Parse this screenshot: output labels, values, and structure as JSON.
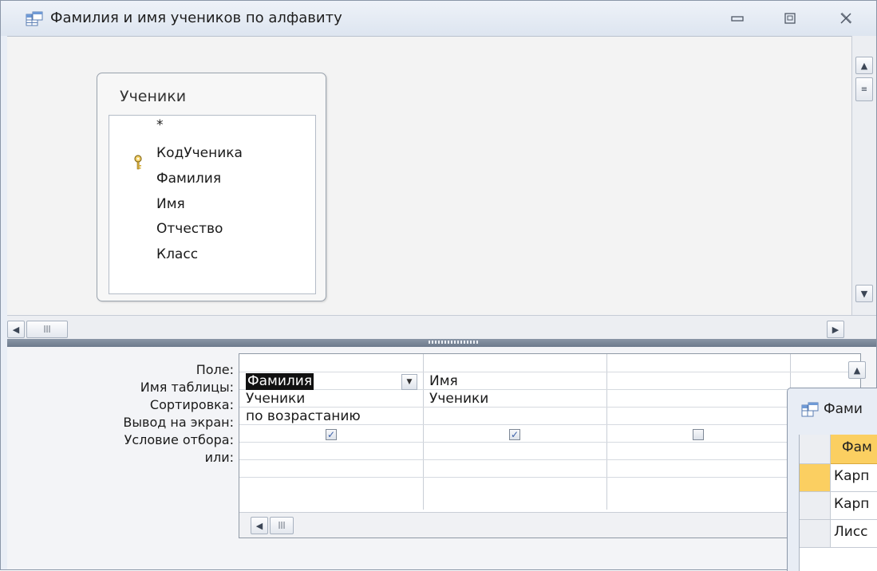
{
  "window": {
    "title": "Фамилия и имя учеников по алфавиту",
    "icon": "query-icon",
    "controls": [
      "minimize-icon",
      "restore-icon",
      "close-icon"
    ]
  },
  "diagram": {
    "table": {
      "name": "Ученики",
      "fields": [
        "*",
        "КодУченика",
        "Фамилия",
        "Имя",
        "Отчество",
        "Класс"
      ],
      "primary_key": "КодУченика"
    }
  },
  "design_grid": {
    "row_labels": {
      "field": "Поле:",
      "table": "Имя таблицы:",
      "sort": "Сортировка:",
      "show": "Вывод на экран:",
      "criteria": "Условие отбора:",
      "or": "или:"
    },
    "columns": [
      {
        "field": "Фамилия",
        "table": "Ученики",
        "sort": "по возрастанию",
        "show": true
      },
      {
        "field": "Имя",
        "table": "Ученики",
        "sort": "",
        "show": true
      },
      {
        "field": "",
        "table": "",
        "sort": "",
        "show": false
      }
    ]
  },
  "datasheet": {
    "title": "Фами",
    "column_header": "Фам",
    "rows": [
      "Карп",
      "Карп",
      "Лисс"
    ],
    "header_color": "#fbcf61",
    "selected_row_color": "#fbcf61"
  }
}
